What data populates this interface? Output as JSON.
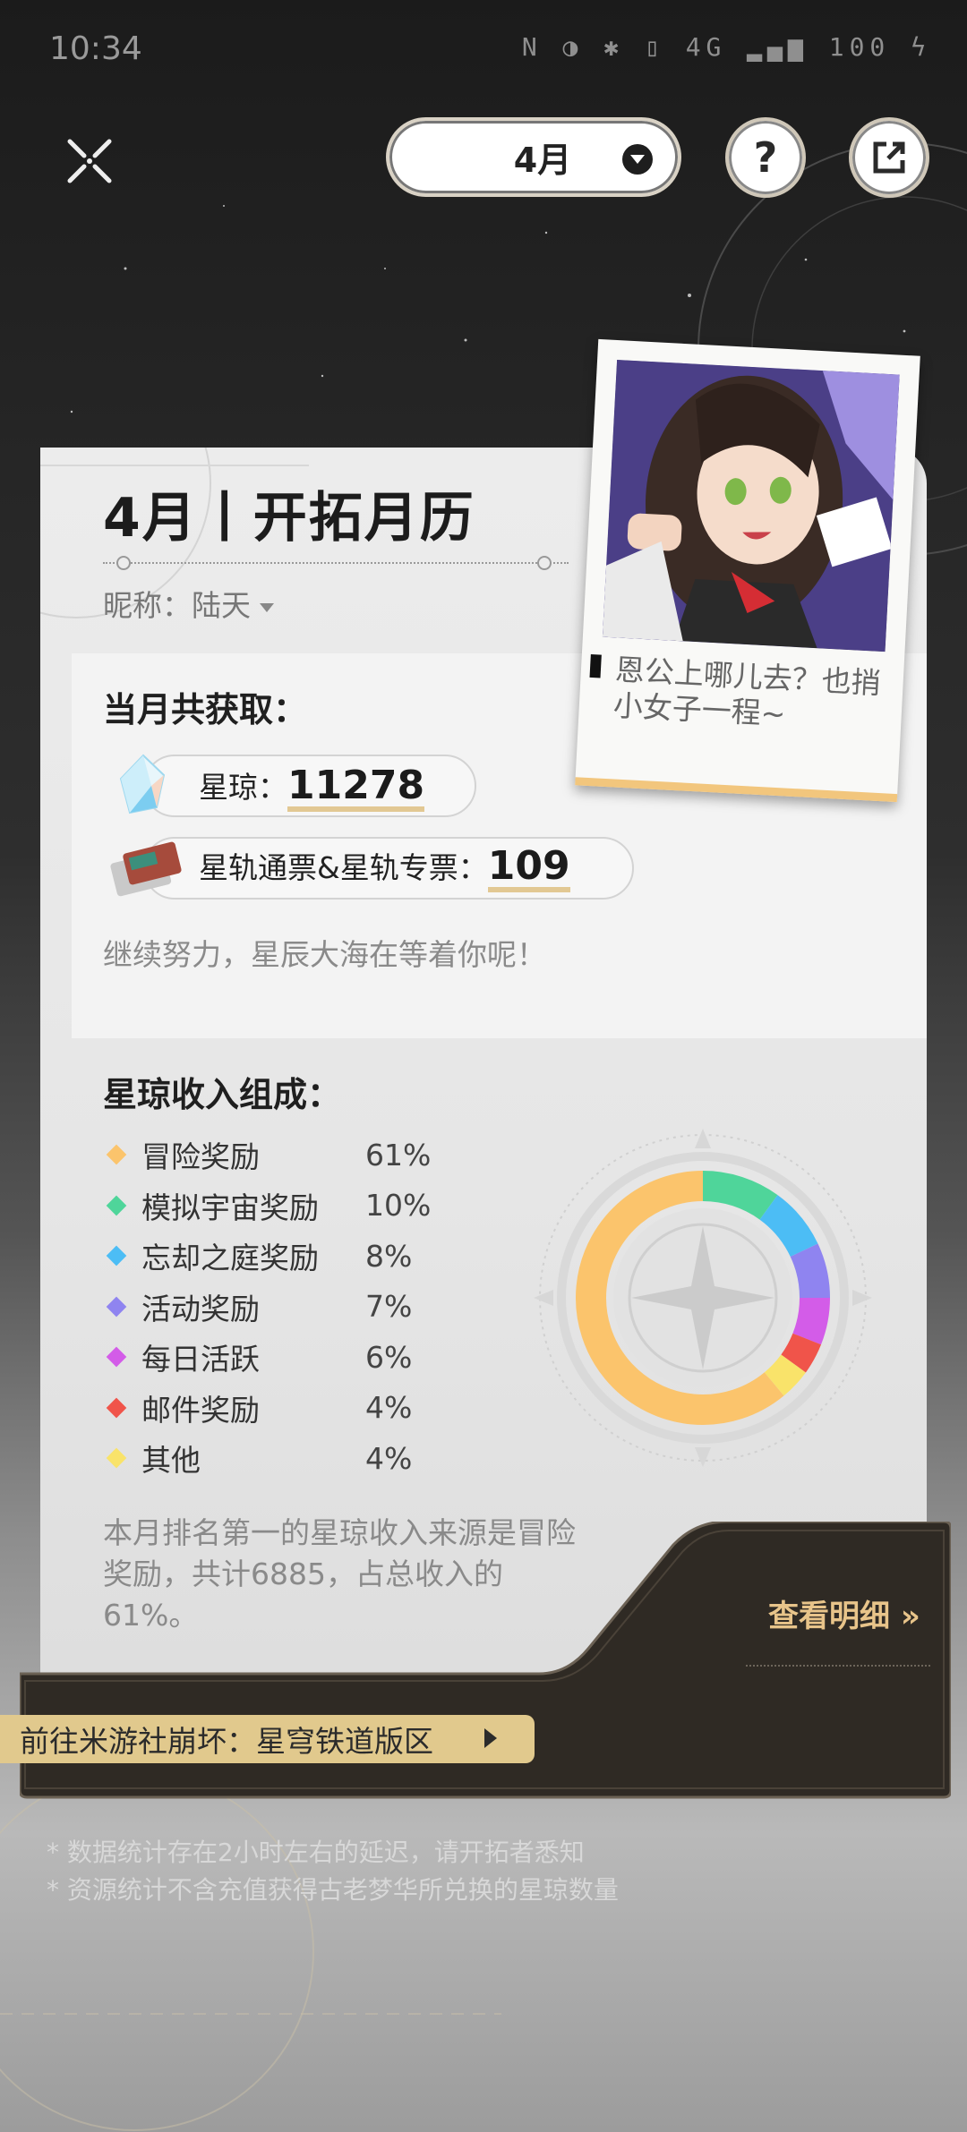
{
  "status_bar": {
    "time": "10:34",
    "icons": "N ◑ ✱ ▯ 4G ▂▄▆ 100 ϟ",
    "battery": "100"
  },
  "top_bar": {
    "month_label": "4月",
    "help_label": "?"
  },
  "card": {
    "title": "4月丨开拓月历",
    "nickname_label": "昵称：",
    "nickname": "陆天",
    "summary": {
      "heading": "当月共获取：",
      "items": [
        {
          "label": "星琼：",
          "value": "11278",
          "icon": "stellar-jade-icon"
        },
        {
          "label": "星轨通票&星轨专票：",
          "value": "109",
          "icon": "star-rail-pass-icon"
        }
      ],
      "encouragement": "继续努力，星辰大海在等着你呢！"
    },
    "polaroid_caption": "恩公上哪儿去？也捎小女子一程~",
    "composition": {
      "heading": "星琼收入组成：",
      "items": [
        {
          "name": "冒险奖励",
          "percent": "61%",
          "value": 61,
          "color": "#fbc46c"
        },
        {
          "name": "模拟宇宙奖励",
          "percent": "10%",
          "value": 10,
          "color": "#4fd59a"
        },
        {
          "name": "忘却之庭奖励",
          "percent": "8%",
          "value": 8,
          "color": "#4cbdf5"
        },
        {
          "name": "活动奖励",
          "percent": "7%",
          "value": 7,
          "color": "#8f84f0"
        },
        {
          "name": "每日活跃",
          "percent": "6%",
          "value": 6,
          "color": "#d35ce8"
        },
        {
          "name": "邮件奖励",
          "percent": "4%",
          "value": 4,
          "color": "#f0544a"
        },
        {
          "name": "其他",
          "percent": "4%",
          "value": 4,
          "color": "#f9e36a"
        }
      ],
      "note": "本月排名第一的星琼收入来源是冒险奖励，共计6885，占总收入的61%。"
    }
  },
  "detail_link": "查看明细 »",
  "forum_button": "前往米游社崩坏：星穹铁道版区",
  "footnotes": [
    "* 数据统计存在2小时左右的延迟，请开拓者悉知",
    "* 资源统计不含充值获得古老梦华所兑换的星琼数量"
  ]
}
